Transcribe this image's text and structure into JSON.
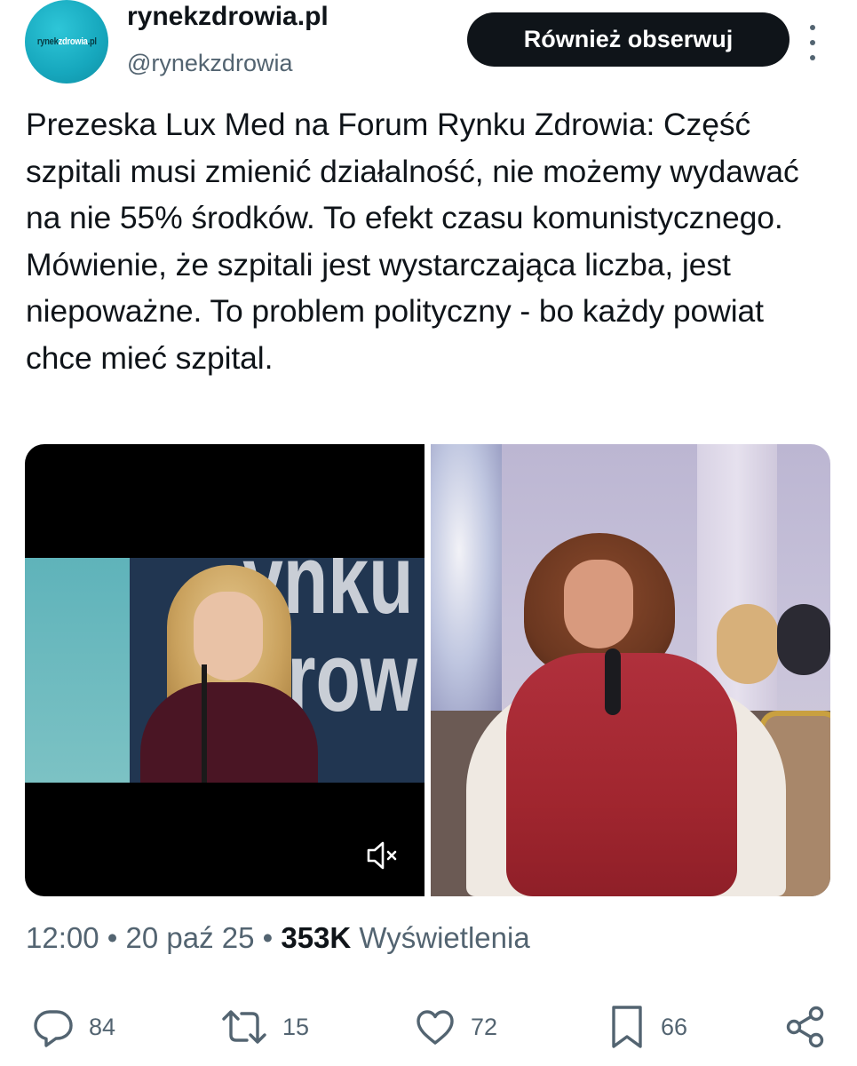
{
  "author": {
    "display_name": "rynekzdrowia.pl",
    "handle": "@rynekzdrowia",
    "avatar_text_a": "rynek",
    "avatar_text_b": "zdrowia",
    "avatar_text_c": ".pl"
  },
  "follow_button": {
    "label": "Również obserwuj"
  },
  "tweet": {
    "text": "Prezeska Lux Med na Forum Rynku Zdrowia: Część szpitali musi zmienić działalność, nie możemy wydawać na nie 55% środków. To efekt czasu komunistycznego. Mówienie, że szpitali jest wystarczająca liczba, jest niepoważne. To problem polityczny - bo każdy powiat chce mieć szpital."
  },
  "media": {
    "video_bg_text": "ynku\ndrow",
    "mute_icon": "speaker-muted-icon"
  },
  "meta": {
    "time": "12:00",
    "sep1": " • ",
    "date": "20 paź 25",
    "sep2": " • ",
    "views_count": "353K",
    "views_label": " Wyświetlenia"
  },
  "actions": {
    "replies": "84",
    "reposts": "15",
    "likes": "72",
    "bookmarks": "66"
  },
  "icons": {
    "reply": "comment-icon",
    "repost": "repost-icon",
    "like": "heart-icon",
    "bookmark": "bookmark-icon",
    "share": "share-icon",
    "more": "more-vertical-icon"
  },
  "colors": {
    "text_primary": "#0f1419",
    "text_secondary": "#536471",
    "button_bg": "#0f1419",
    "avatar_bg": "#16a7bd"
  }
}
